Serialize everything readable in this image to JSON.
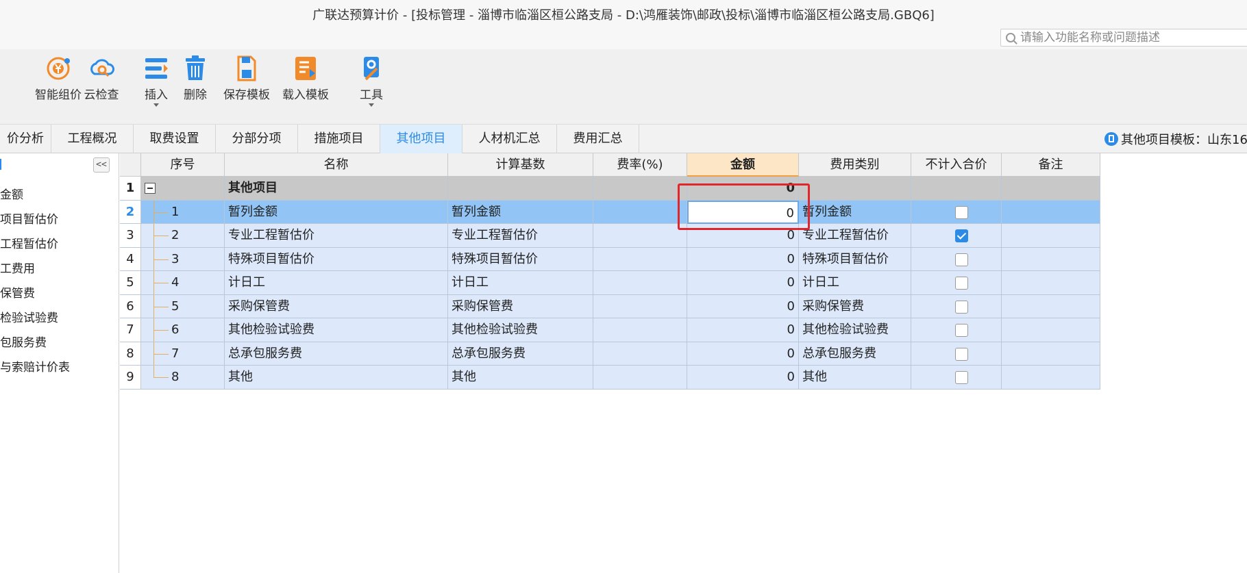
{
  "window": {
    "title": "广联达预算计价 - [投标管理 - 淄博市临淄区桓公路支局 - D:\\鸿雁装饰\\邮政\\投标\\淄博市临淄区桓公路支局.GBQ6]"
  },
  "search": {
    "placeholder": "请输入功能名称或问题描述"
  },
  "ribbon": {
    "smart_price": "智能组价",
    "cloud_check": "云检查",
    "insert": "插入",
    "delete": "删除",
    "save_template": "保存模板",
    "load_template": "载入模板",
    "tools": "工具"
  },
  "tabs": [
    {
      "label": "价分析"
    },
    {
      "label": "工程概况"
    },
    {
      "label": "取费设置"
    },
    {
      "label": "分部分项"
    },
    {
      "label": "措施项目"
    },
    {
      "label": "其他项目"
    },
    {
      "label": "人材机汇总"
    },
    {
      "label": "费用汇总"
    }
  ],
  "template_info": "其他项目模板：山东16",
  "left_panel": {
    "collapse_glyph": "<<",
    "items": [
      "金额",
      "项目暂估价",
      "工程暂估价",
      "工费用",
      "保管费",
      "检验试验费",
      "包服务费",
      "与索赔计价表"
    ]
  },
  "table": {
    "headers": {
      "seq": "序号",
      "name": "名称",
      "base": "计算基数",
      "rate": "费率(%)",
      "amount": "金额",
      "category": "费用类别",
      "exclude": "不计入合价",
      "remark": "备注"
    },
    "parent": {
      "row": "1",
      "name": "其他项目",
      "amount": "0"
    },
    "rows": [
      {
        "row": "2",
        "seq": "1",
        "name": "暂列金额",
        "base": "暂列金额",
        "amount": "0",
        "category": "暂列金额",
        "excluded": false
      },
      {
        "row": "3",
        "seq": "2",
        "name": "专业工程暂估价",
        "base": "专业工程暂估价",
        "amount": "0",
        "category": "专业工程暂估价",
        "excluded": true
      },
      {
        "row": "4",
        "seq": "3",
        "name": "特殊项目暂估价",
        "base": "特殊项目暂估价",
        "amount": "0",
        "category": "特殊项目暂估价",
        "excluded": false
      },
      {
        "row": "5",
        "seq": "4",
        "name": "计日工",
        "base": "计日工",
        "amount": "0",
        "category": "计日工",
        "excluded": false
      },
      {
        "row": "6",
        "seq": "5",
        "name": "采购保管费",
        "base": "采购保管费",
        "amount": "0",
        "category": "采购保管费",
        "excluded": false
      },
      {
        "row": "7",
        "seq": "6",
        "name": "其他检验试验费",
        "base": "其他检验试验费",
        "amount": "0",
        "category": "其他检验试验费",
        "excluded": false
      },
      {
        "row": "8",
        "seq": "7",
        "name": "总承包服务费",
        "base": "总承包服务费",
        "amount": "0",
        "category": "总承包服务费",
        "excluded": false
      },
      {
        "row": "9",
        "seq": "8",
        "name": "其他",
        "base": "其他",
        "amount": "0",
        "category": "其他",
        "excluded": false
      }
    ]
  },
  "colors": {
    "accent": "#2b8be6",
    "selected_row": "#92c5f6",
    "child_row": "#dde9fb",
    "highlight": "#e0262b"
  }
}
